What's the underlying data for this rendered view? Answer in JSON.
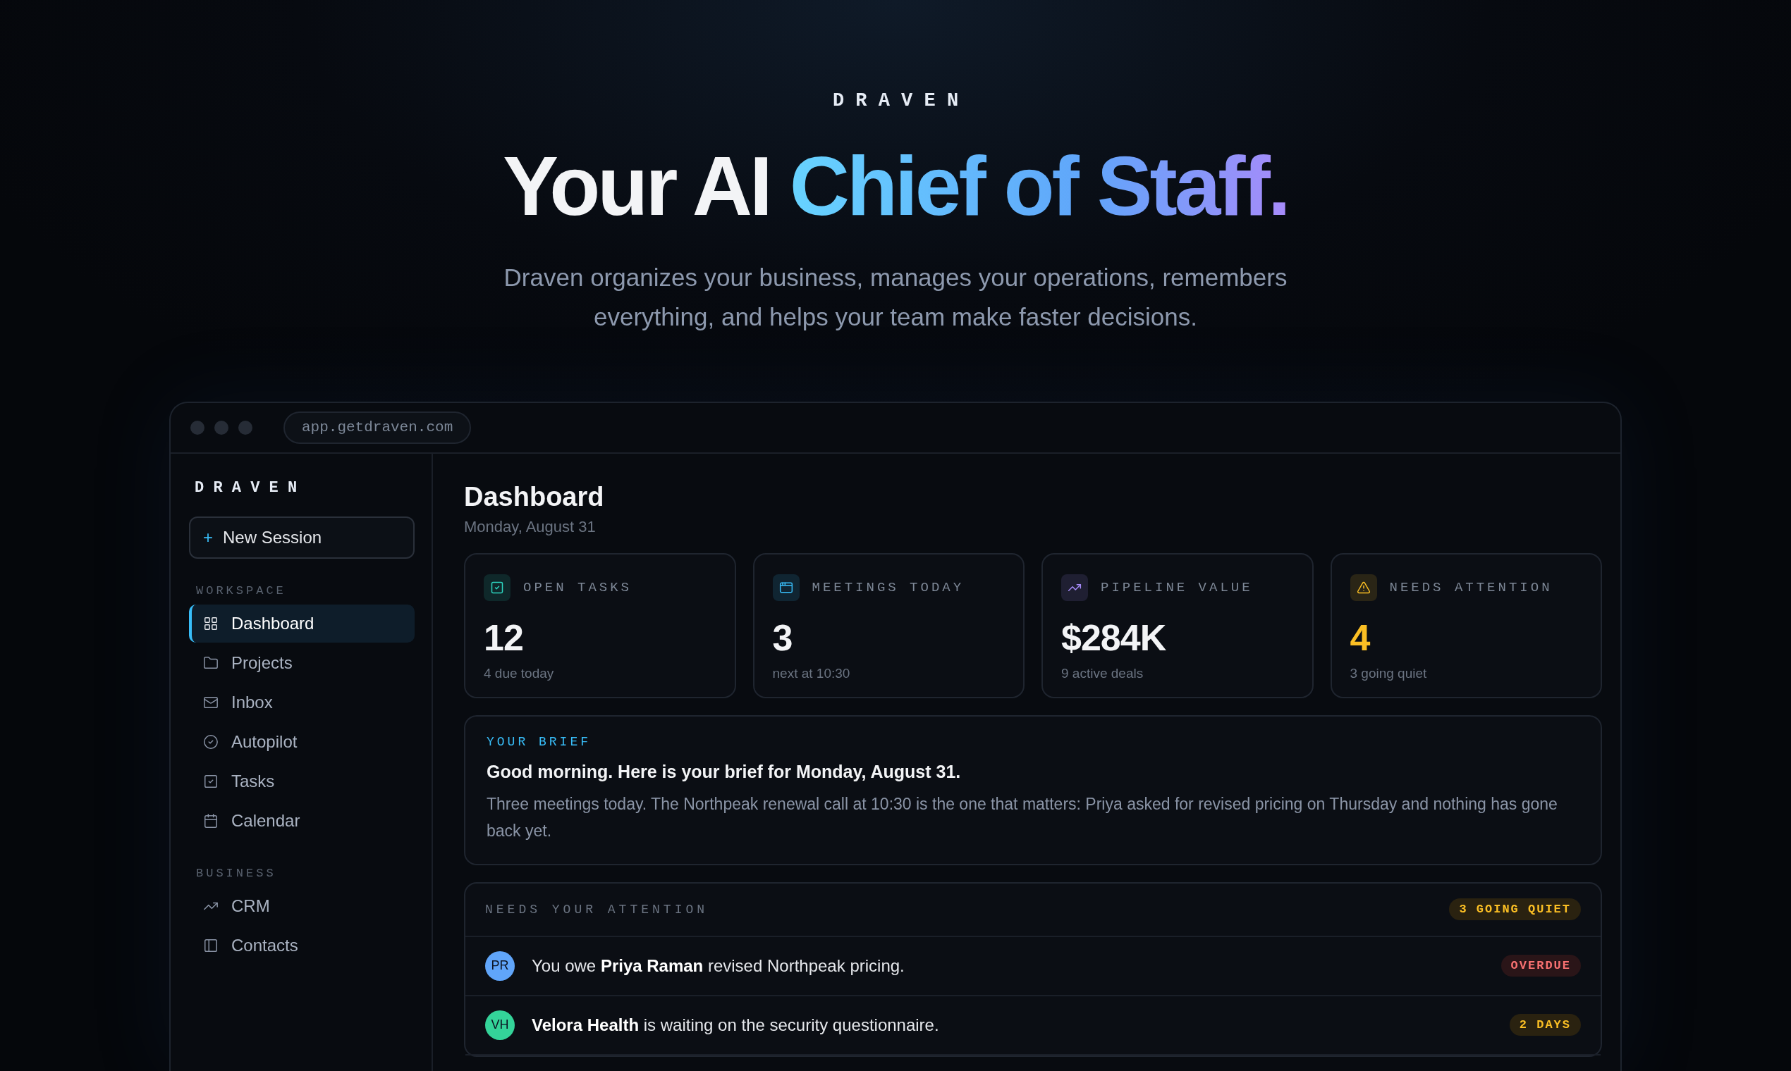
{
  "hero": {
    "brand": "D R A V E N",
    "headline": {
      "plain": "Your AI",
      "accent": "Chief of Staff."
    },
    "subtitle": "Draven organizes your business, manages your operations, remembers everything, and helps your team make faster decisions."
  },
  "browser": {
    "url": "app.getdraven.com"
  },
  "sidebar": {
    "brand": "D R A V E N",
    "new_session": {
      "icon": "+",
      "label": "New Session"
    },
    "sections": [
      {
        "title": "WORKSPACE",
        "items": [
          {
            "label": "Dashboard",
            "kind": "grid",
            "selected": true
          },
          {
            "label": "Projects",
            "kind": "folder",
            "selected": false
          },
          {
            "label": "Inbox",
            "kind": "mail",
            "selected": false
          },
          {
            "label": "Autopilot",
            "kind": "circlecheck",
            "selected": false
          },
          {
            "label": "Tasks",
            "kind": "squarecheck",
            "selected": false
          },
          {
            "label": "Calendar",
            "kind": "calendar",
            "selected": false
          }
        ]
      },
      {
        "title": "BUSINESS",
        "items": [
          {
            "label": "CRM",
            "kind": "trend",
            "selected": false
          },
          {
            "label": "Contacts",
            "kind": "panel",
            "selected": false
          }
        ]
      }
    ]
  },
  "dashboard": {
    "title": "Dashboard",
    "date": "Monday, August 31",
    "stats": [
      {
        "kind": "tasks",
        "color": "#2dd4bf",
        "label": "OPEN TASKS",
        "value": "12",
        "note": "4 due today",
        "highlight": false
      },
      {
        "kind": "meetings",
        "color": "#38bdf8",
        "label": "MEETINGS TODAY",
        "value": "3",
        "note": "next at 10:30",
        "highlight": false
      },
      {
        "kind": "pipeline",
        "color": "#a78bfa",
        "label": "PIPELINE VALUE",
        "value": "$284K",
        "note": "9 active deals",
        "highlight": false
      },
      {
        "kind": "attention",
        "color": "#fbbf24",
        "label": "NEEDS ATTENTION",
        "value": "4",
        "note": "3 going quiet",
        "highlight": true
      }
    ],
    "brief": {
      "label": "YOUR BRIEF",
      "heading": "Good morning. Here is your brief for Monday, August 31.",
      "body": "Three meetings today. The Northpeak renewal call at 10:30 is the one that matters: Priya asked for revised pricing on Thursday and nothing has gone back yet."
    },
    "attention": {
      "title": "NEEDS YOUR ATTENTION",
      "badge": "3 GOING QUIET",
      "rows": [
        {
          "initials": "PR",
          "color": "#60a5fa",
          "text": "You owe **Priya Raman** revised Northpeak pricing.",
          "tag": "OVERDUE",
          "kind": "overdue"
        },
        {
          "initials": "VH",
          "color": "#34d399",
          "text": "**Velora Health** is waiting on the security questionnaire.",
          "tag": "2 DAYS",
          "kind": "days"
        }
      ]
    }
  }
}
